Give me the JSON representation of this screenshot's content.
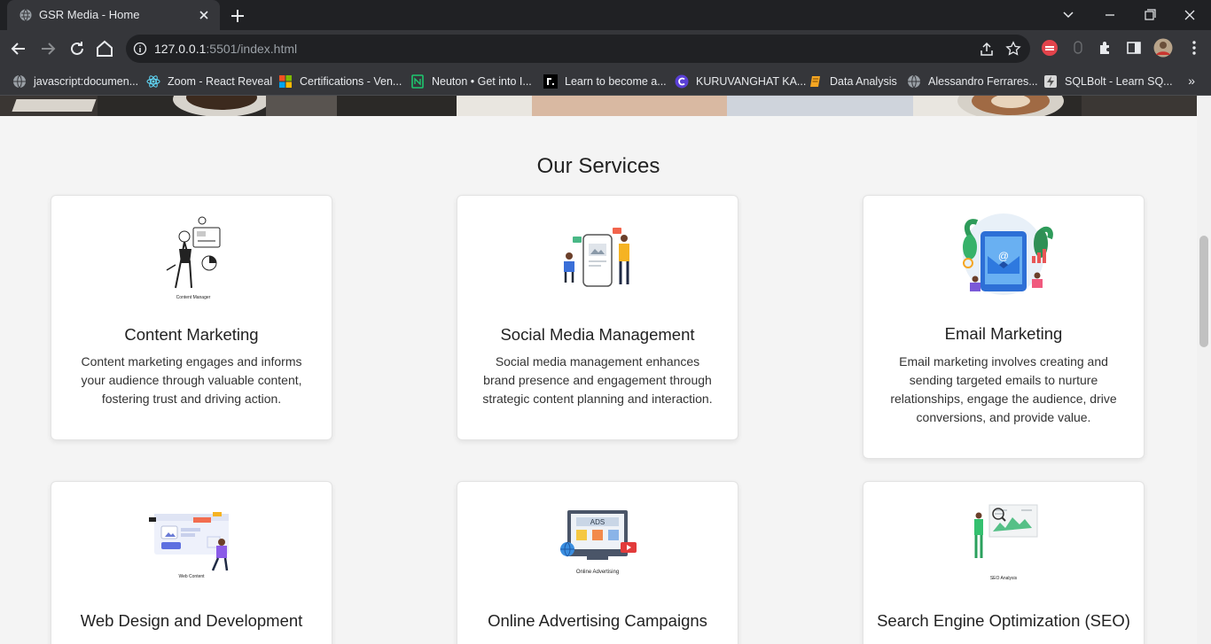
{
  "browser": {
    "tab_title": "GSR Media - Home",
    "url_host": "127.0.0.1",
    "url_rest": ":5501/index.html",
    "bookmarks": [
      {
        "label": "javascript:documen...",
        "icon": "globe-icon"
      },
      {
        "label": "Zoom - React Reveal",
        "icon": "react-icon"
      },
      {
        "label": "Certifications - Ven...",
        "icon": "microsoft-icon"
      },
      {
        "label": "Neuton • Get into I...",
        "icon": "neuton-icon"
      },
      {
        "label": "Learn to become a...",
        "icon": "r-logo-icon"
      },
      {
        "label": "KURUVANGHAT KA...",
        "icon": "c-logo-icon"
      },
      {
        "label": "Data Analysis",
        "icon": "book-icon"
      },
      {
        "label": "Alessandro Ferrares...",
        "icon": "globe-icon"
      },
      {
        "label": "SQLBolt - Learn SQ...",
        "icon": "bolt-icon"
      }
    ],
    "more_bookmarks": "»"
  },
  "page": {
    "section_title": "Our Services",
    "services": [
      {
        "title": "Content Marketing",
        "description": "Content marketing engages and informs your audience through valuable content, fostering trust and driving action.",
        "illustration_caption": "Content Manager"
      },
      {
        "title": "Social Media Management",
        "description": "Social media management enhances brand presence and engagement through strategic content planning and interaction.",
        "illustration_caption": ""
      },
      {
        "title": "Email Marketing",
        "description": "Email marketing involves creating and sending targeted emails to nurture relationships, engage the audience, drive conversions, and provide value.",
        "illustration_caption": ""
      },
      {
        "title": "Web Design and Development",
        "description": "",
        "illustration_caption": "Web Content"
      },
      {
        "title": "Online Advertising Campaigns",
        "description": "",
        "illustration_caption": "Online Advertising",
        "ads_label": "ADS"
      },
      {
        "title": "Search Engine Optimization (SEO)",
        "description": "",
        "illustration_caption": "SEO Analysis"
      }
    ]
  },
  "colors": {
    "chrome_dark": "#202124",
    "chrome_toolbar": "#35363a",
    "page_bg": "#f4f4f4",
    "card_bg": "#ffffff",
    "text": "#222222"
  }
}
